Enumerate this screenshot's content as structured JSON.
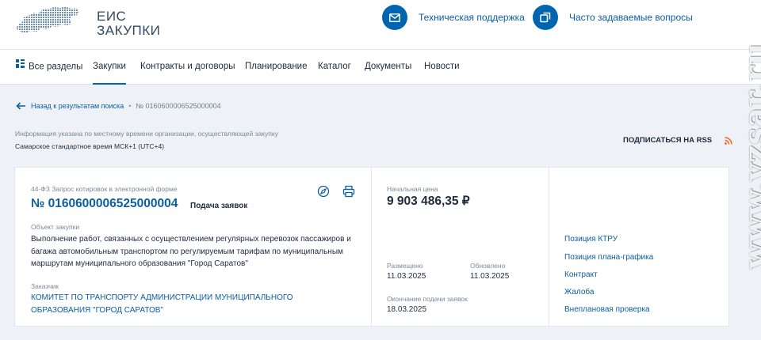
{
  "header": {
    "logo_line1": "ЕИС",
    "logo_line2": "ЗАКУПКИ",
    "support_label": "Техническая поддержка",
    "faq_label": "Часто задаваемые вопросы",
    "accent_color": "#0065b1"
  },
  "nav": {
    "items": [
      {
        "label": "Все разделы",
        "icon": "grid-icon"
      },
      {
        "label": "Закупки",
        "active": true
      },
      {
        "label": "Контракты и договоры"
      },
      {
        "label": "Планирование"
      },
      {
        "label": "Каталог"
      },
      {
        "label": "Документы"
      },
      {
        "label": "Новости"
      }
    ]
  },
  "breadcrumb": {
    "back_label": "Назад к результатам поиска",
    "separator": "•",
    "current": "№ 0160600006525000004"
  },
  "timezone": {
    "note": "Информация указана по местному времени организации, осуществляющей закупку",
    "value": "Самарское стандартное время МСК+1 (UTC+4)"
  },
  "rss_label": "ПОДПИСАТЬСЯ НА RSS",
  "card": {
    "procurement_type": "44-ФЗ Запрос котировок в электронной форме",
    "number": "№ 0160600006525000004",
    "status": "Подача заявок",
    "object_label": "Объект закупки",
    "object_value": "Выполнение работ, связанных с осуществлением регулярных перевозок пассажиров и багажа автомобильным транспортом по регулируемым тарифам по муниципальным маршрутам муниципального образования \"Город Саратов\"",
    "customer_label": "Заказчик",
    "customer_value": "КОМИТЕТ ПО ТРАНСПОРТУ АДМИНИСТРАЦИИ МУНИЦИПАЛЬНОГО ОБРАЗОВАНИЯ \"ГОРОД САРАТОВ\"",
    "price_label": "Начальная цена",
    "price_value": "9 903 486,35 ₽",
    "posted_label": "Размещено",
    "posted_value": "11.03.2025",
    "updated_label": "Обновлено",
    "updated_value": "11.03.2025",
    "deadline_label": "Окончание подачи заявок",
    "deadline_value": "18.03.2025",
    "links": [
      "Позиция КТРУ",
      "Позиция плана-графика",
      "Контракт",
      "Жалоба",
      "Внеплановая проверка"
    ]
  },
  "watermark": "www.vzsar.ru"
}
